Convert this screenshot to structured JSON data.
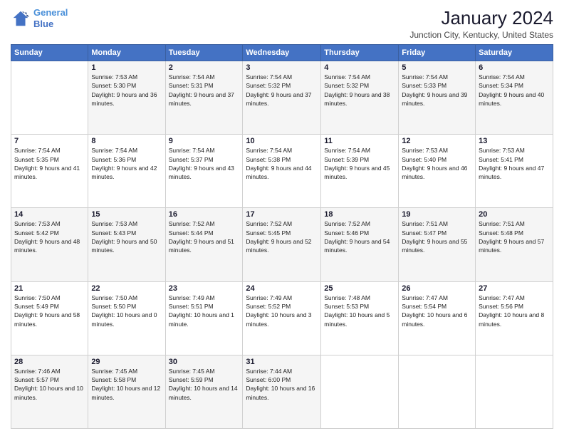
{
  "logo": {
    "line1": "General",
    "line2": "Blue"
  },
  "title": "January 2024",
  "location": "Junction City, Kentucky, United States",
  "days_of_week": [
    "Sunday",
    "Monday",
    "Tuesday",
    "Wednesday",
    "Thursday",
    "Friday",
    "Saturday"
  ],
  "weeks": [
    [
      {
        "day": "",
        "sunrise": "",
        "sunset": "",
        "daylight": ""
      },
      {
        "day": "1",
        "sunrise": "Sunrise: 7:53 AM",
        "sunset": "Sunset: 5:30 PM",
        "daylight": "Daylight: 9 hours and 36 minutes."
      },
      {
        "day": "2",
        "sunrise": "Sunrise: 7:54 AM",
        "sunset": "Sunset: 5:31 PM",
        "daylight": "Daylight: 9 hours and 37 minutes."
      },
      {
        "day": "3",
        "sunrise": "Sunrise: 7:54 AM",
        "sunset": "Sunset: 5:32 PM",
        "daylight": "Daylight: 9 hours and 37 minutes."
      },
      {
        "day": "4",
        "sunrise": "Sunrise: 7:54 AM",
        "sunset": "Sunset: 5:32 PM",
        "daylight": "Daylight: 9 hours and 38 minutes."
      },
      {
        "day": "5",
        "sunrise": "Sunrise: 7:54 AM",
        "sunset": "Sunset: 5:33 PM",
        "daylight": "Daylight: 9 hours and 39 minutes."
      },
      {
        "day": "6",
        "sunrise": "Sunrise: 7:54 AM",
        "sunset": "Sunset: 5:34 PM",
        "daylight": "Daylight: 9 hours and 40 minutes."
      }
    ],
    [
      {
        "day": "7",
        "sunrise": "Sunrise: 7:54 AM",
        "sunset": "Sunset: 5:35 PM",
        "daylight": "Daylight: 9 hours and 41 minutes."
      },
      {
        "day": "8",
        "sunrise": "Sunrise: 7:54 AM",
        "sunset": "Sunset: 5:36 PM",
        "daylight": "Daylight: 9 hours and 42 minutes."
      },
      {
        "day": "9",
        "sunrise": "Sunrise: 7:54 AM",
        "sunset": "Sunset: 5:37 PM",
        "daylight": "Daylight: 9 hours and 43 minutes."
      },
      {
        "day": "10",
        "sunrise": "Sunrise: 7:54 AM",
        "sunset": "Sunset: 5:38 PM",
        "daylight": "Daylight: 9 hours and 44 minutes."
      },
      {
        "day": "11",
        "sunrise": "Sunrise: 7:54 AM",
        "sunset": "Sunset: 5:39 PM",
        "daylight": "Daylight: 9 hours and 45 minutes."
      },
      {
        "day": "12",
        "sunrise": "Sunrise: 7:53 AM",
        "sunset": "Sunset: 5:40 PM",
        "daylight": "Daylight: 9 hours and 46 minutes."
      },
      {
        "day": "13",
        "sunrise": "Sunrise: 7:53 AM",
        "sunset": "Sunset: 5:41 PM",
        "daylight": "Daylight: 9 hours and 47 minutes."
      }
    ],
    [
      {
        "day": "14",
        "sunrise": "Sunrise: 7:53 AM",
        "sunset": "Sunset: 5:42 PM",
        "daylight": "Daylight: 9 hours and 48 minutes."
      },
      {
        "day": "15",
        "sunrise": "Sunrise: 7:53 AM",
        "sunset": "Sunset: 5:43 PM",
        "daylight": "Daylight: 9 hours and 50 minutes."
      },
      {
        "day": "16",
        "sunrise": "Sunrise: 7:52 AM",
        "sunset": "Sunset: 5:44 PM",
        "daylight": "Daylight: 9 hours and 51 minutes."
      },
      {
        "day": "17",
        "sunrise": "Sunrise: 7:52 AM",
        "sunset": "Sunset: 5:45 PM",
        "daylight": "Daylight: 9 hours and 52 minutes."
      },
      {
        "day": "18",
        "sunrise": "Sunrise: 7:52 AM",
        "sunset": "Sunset: 5:46 PM",
        "daylight": "Daylight: 9 hours and 54 minutes."
      },
      {
        "day": "19",
        "sunrise": "Sunrise: 7:51 AM",
        "sunset": "Sunset: 5:47 PM",
        "daylight": "Daylight: 9 hours and 55 minutes."
      },
      {
        "day": "20",
        "sunrise": "Sunrise: 7:51 AM",
        "sunset": "Sunset: 5:48 PM",
        "daylight": "Daylight: 9 hours and 57 minutes."
      }
    ],
    [
      {
        "day": "21",
        "sunrise": "Sunrise: 7:50 AM",
        "sunset": "Sunset: 5:49 PM",
        "daylight": "Daylight: 9 hours and 58 minutes."
      },
      {
        "day": "22",
        "sunrise": "Sunrise: 7:50 AM",
        "sunset": "Sunset: 5:50 PM",
        "daylight": "Daylight: 10 hours and 0 minutes."
      },
      {
        "day": "23",
        "sunrise": "Sunrise: 7:49 AM",
        "sunset": "Sunset: 5:51 PM",
        "daylight": "Daylight: 10 hours and 1 minute."
      },
      {
        "day": "24",
        "sunrise": "Sunrise: 7:49 AM",
        "sunset": "Sunset: 5:52 PM",
        "daylight": "Daylight: 10 hours and 3 minutes."
      },
      {
        "day": "25",
        "sunrise": "Sunrise: 7:48 AM",
        "sunset": "Sunset: 5:53 PM",
        "daylight": "Daylight: 10 hours and 5 minutes."
      },
      {
        "day": "26",
        "sunrise": "Sunrise: 7:47 AM",
        "sunset": "Sunset: 5:54 PM",
        "daylight": "Daylight: 10 hours and 6 minutes."
      },
      {
        "day": "27",
        "sunrise": "Sunrise: 7:47 AM",
        "sunset": "Sunset: 5:56 PM",
        "daylight": "Daylight: 10 hours and 8 minutes."
      }
    ],
    [
      {
        "day": "28",
        "sunrise": "Sunrise: 7:46 AM",
        "sunset": "Sunset: 5:57 PM",
        "daylight": "Daylight: 10 hours and 10 minutes."
      },
      {
        "day": "29",
        "sunrise": "Sunrise: 7:45 AM",
        "sunset": "Sunset: 5:58 PM",
        "daylight": "Daylight: 10 hours and 12 minutes."
      },
      {
        "day": "30",
        "sunrise": "Sunrise: 7:45 AM",
        "sunset": "Sunset: 5:59 PM",
        "daylight": "Daylight: 10 hours and 14 minutes."
      },
      {
        "day": "31",
        "sunrise": "Sunrise: 7:44 AM",
        "sunset": "Sunset: 6:00 PM",
        "daylight": "Daylight: 10 hours and 16 minutes."
      },
      {
        "day": "",
        "sunrise": "",
        "sunset": "",
        "daylight": ""
      },
      {
        "day": "",
        "sunrise": "",
        "sunset": "",
        "daylight": ""
      },
      {
        "day": "",
        "sunrise": "",
        "sunset": "",
        "daylight": ""
      }
    ]
  ]
}
